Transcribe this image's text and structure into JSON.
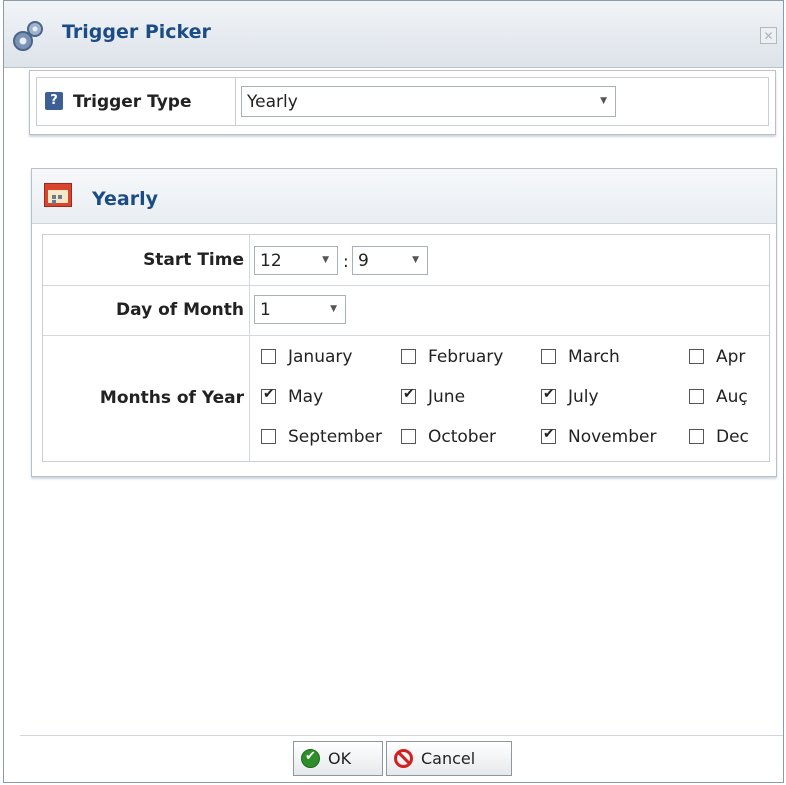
{
  "window": {
    "title": "Trigger Picker",
    "close_icon": "close-icon"
  },
  "trigger_type": {
    "label": "Trigger Type",
    "value": "Yearly"
  },
  "yearly": {
    "title": "Yearly",
    "start_time": {
      "label": "Start Time",
      "hour": "12",
      "minute": "9",
      "separator": ":"
    },
    "day_of_month": {
      "label": "Day of Month",
      "value": "1"
    },
    "months": {
      "label": "Months of Year",
      "items": [
        {
          "name": "January",
          "checked": false
        },
        {
          "name": "February",
          "checked": false
        },
        {
          "name": "March",
          "checked": false
        },
        {
          "name": "Apr",
          "checked": false
        },
        {
          "name": "May",
          "checked": true
        },
        {
          "name": "June",
          "checked": true
        },
        {
          "name": "July",
          "checked": true
        },
        {
          "name": "Auç",
          "checked": false
        },
        {
          "name": "September",
          "checked": false
        },
        {
          "name": "October",
          "checked": false
        },
        {
          "name": "November",
          "checked": true
        },
        {
          "name": "Dec",
          "checked": false
        }
      ]
    }
  },
  "buttons": {
    "ok": "OK",
    "cancel": "Cancel"
  },
  "colors": {
    "title": "#1c4c86",
    "ok": "#2e8f2a",
    "cancel": "#d22020"
  }
}
